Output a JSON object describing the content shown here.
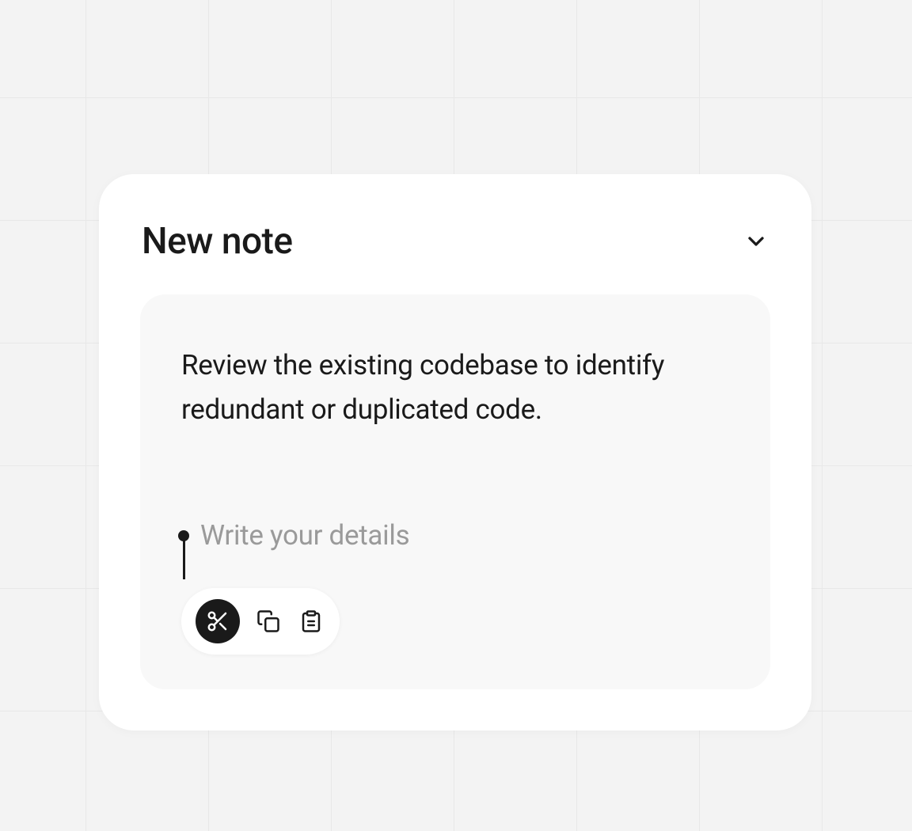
{
  "card": {
    "title": "New note",
    "body_text": "Review the existing codebase to identify redundant or duplicated code.",
    "placeholder": "Write your details"
  },
  "toolbar": {
    "cut_label": "Cut",
    "copy_label": "Copy",
    "paste_label": "Paste"
  }
}
